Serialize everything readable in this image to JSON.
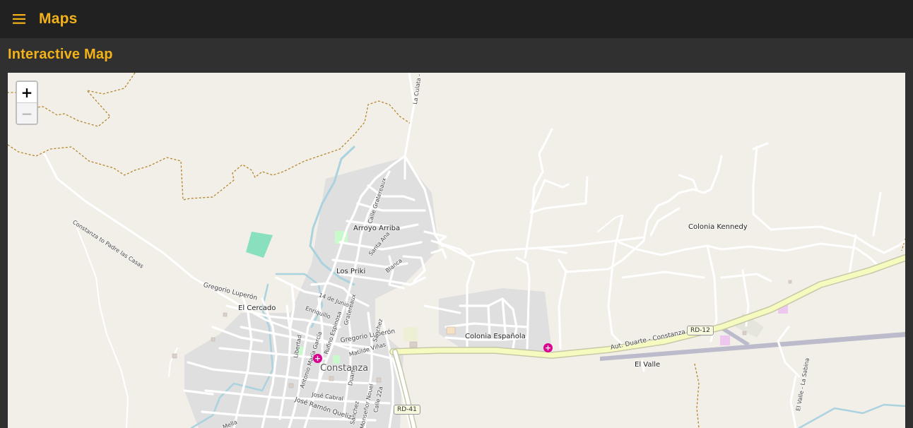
{
  "app": {
    "title": "Maps"
  },
  "page": {
    "heading": "Interactive Map"
  },
  "map": {
    "zoom_in_label": "+",
    "zoom_out_label": "−",
    "zoom_out_disabled": true,
    "labels": {
      "colonia_kennedy": "Colonia Kennedy",
      "arroyo_arriba": "Arroyo Arriba",
      "los_priki": "Los Priki",
      "el_cercado": "El Cercado",
      "colonia_espanola": "Colonia Española",
      "constanza": "Constanza",
      "el_valle": "El Valle"
    },
    "streets": {
      "constanza_padre": "Constanza to Padre las Casas",
      "gregorio_luperon_w": "Gregorio Luperón",
      "gregorio_luperon_e": "Gregorio Luperón",
      "aut_duarte": "Aut. Duarte - Constanza",
      "la_culata": "La Culata - Co",
      "calle_gratereaux": "Calle Gratereaux",
      "gratereaux": "Gratereaux",
      "santa_ana": "Santa Ana",
      "blanca": "Blanca",
      "catorce_junio": "14 de Junio",
      "enriquillo": "Enriquillo",
      "rufino_espinosa": "Rufino Espinosa",
      "libertad": "Libertad",
      "antonio_maria_garcia": "Antonio María García",
      "matilde_vinas": "Matilde Viñas",
      "sanchez": "Sánchez",
      "duarte": "Duarte",
      "jose_cabral": "José Cabral",
      "jose_ramon_queliz": "José Ramón Queliz",
      "sanchez_2": "Sánchez",
      "monsenor_nouel": "Monseñor Nouel",
      "calle_22a": "Calle 22a",
      "mella": "Mella",
      "el_valle_la_sabina": "El Valle - La Sabina"
    },
    "shields": {
      "rd12": "RD-12",
      "rd41": "RD-41"
    },
    "pois": [
      "hospital",
      "hospital"
    ],
    "colors": {
      "background": "#F2EFE9",
      "residential": "#E0DFDF",
      "trunk_road": "#F7FABF",
      "river": "#AAD3DF",
      "boundary": "#B5862B",
      "runway": "#BBBBCC",
      "park": "#C8FACC",
      "pitch": "#88E0BE",
      "hospital": "#DA0092",
      "accent": "#F2B218"
    }
  }
}
